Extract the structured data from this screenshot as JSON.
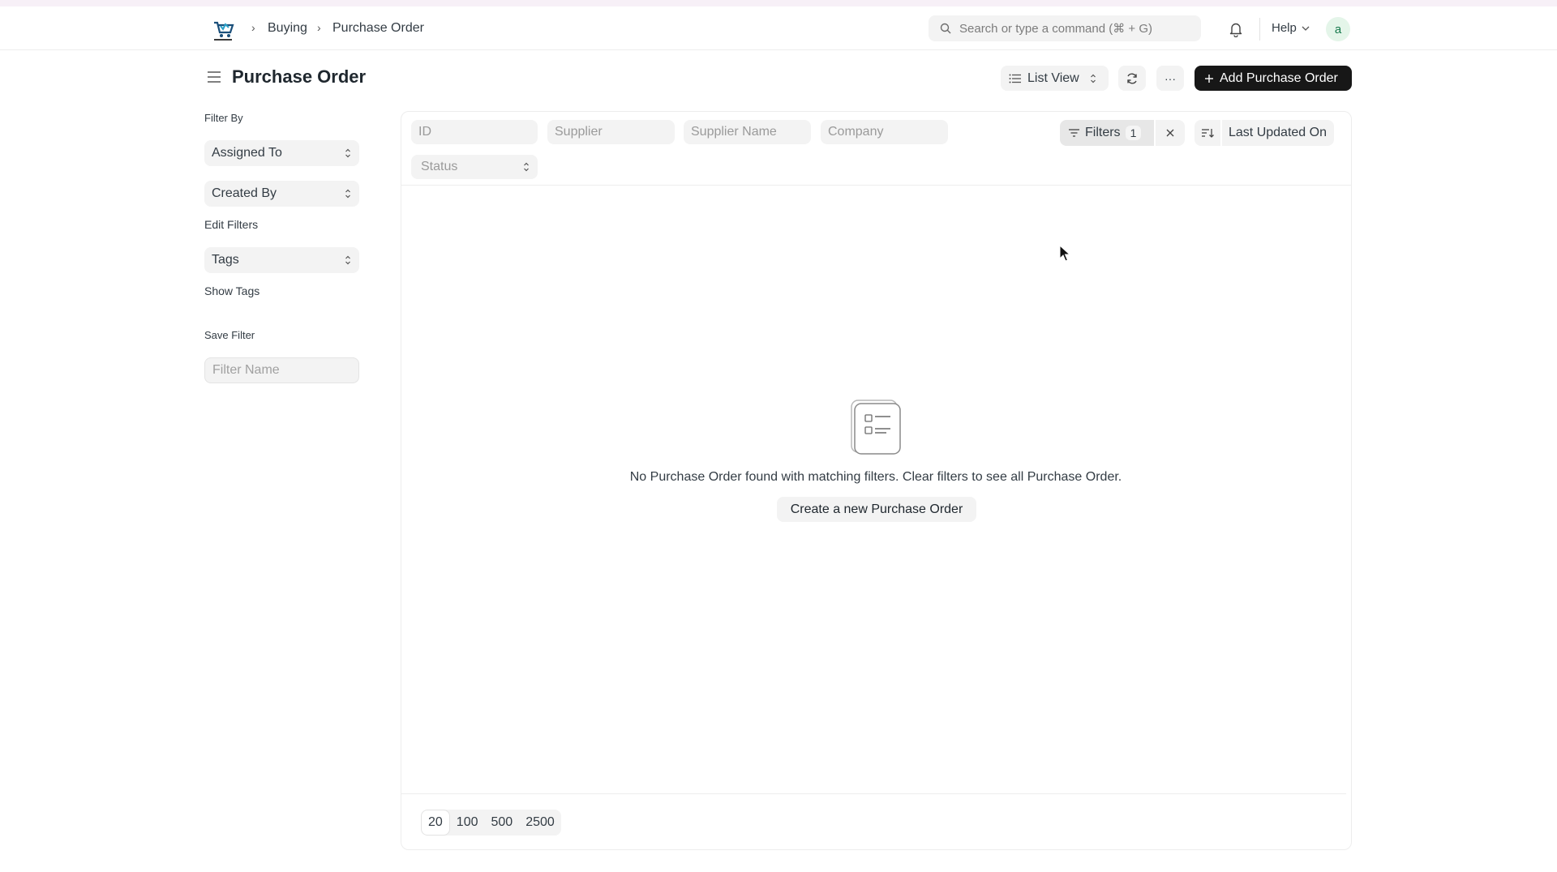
{
  "breadcrumb": {
    "items": [
      "Buying",
      "Purchase Order"
    ]
  },
  "search": {
    "placeholder": "Search or type a command (⌘ + G)"
  },
  "navbar": {
    "help_label": "Help",
    "avatar_initial": "a"
  },
  "page": {
    "title": "Purchase Order",
    "view_label": "List View",
    "more_label": "···",
    "add_label": "Add Purchase Order"
  },
  "sidebar": {
    "filter_by_label": "Filter By",
    "assigned_to": "Assigned To",
    "created_by": "Created By",
    "edit_filters": "Edit Filters",
    "tags": "Tags",
    "show_tags": "Show Tags",
    "save_filter_label": "Save Filter",
    "filter_name_placeholder": "Filter Name"
  },
  "filters": {
    "id_placeholder": "ID",
    "supplier_placeholder": "Supplier",
    "supplier_name_placeholder": "Supplier Name",
    "company_placeholder": "Company",
    "status_placeholder": "Status",
    "filters_label": "Filters",
    "filters_count": "1",
    "sort_label": "Last Updated On"
  },
  "empty_state": {
    "message": "No Purchase Order found with matching filters. Clear filters to see all Purchase Order.",
    "create_label": "Create a new Purchase Order"
  },
  "paging": {
    "sizes": [
      "20",
      "100",
      "500",
      "2500"
    ],
    "active": "20"
  },
  "colors": {
    "primary_button": "#171717",
    "avatar_bg": "#e4f5e9",
    "avatar_text": "#16794c"
  }
}
